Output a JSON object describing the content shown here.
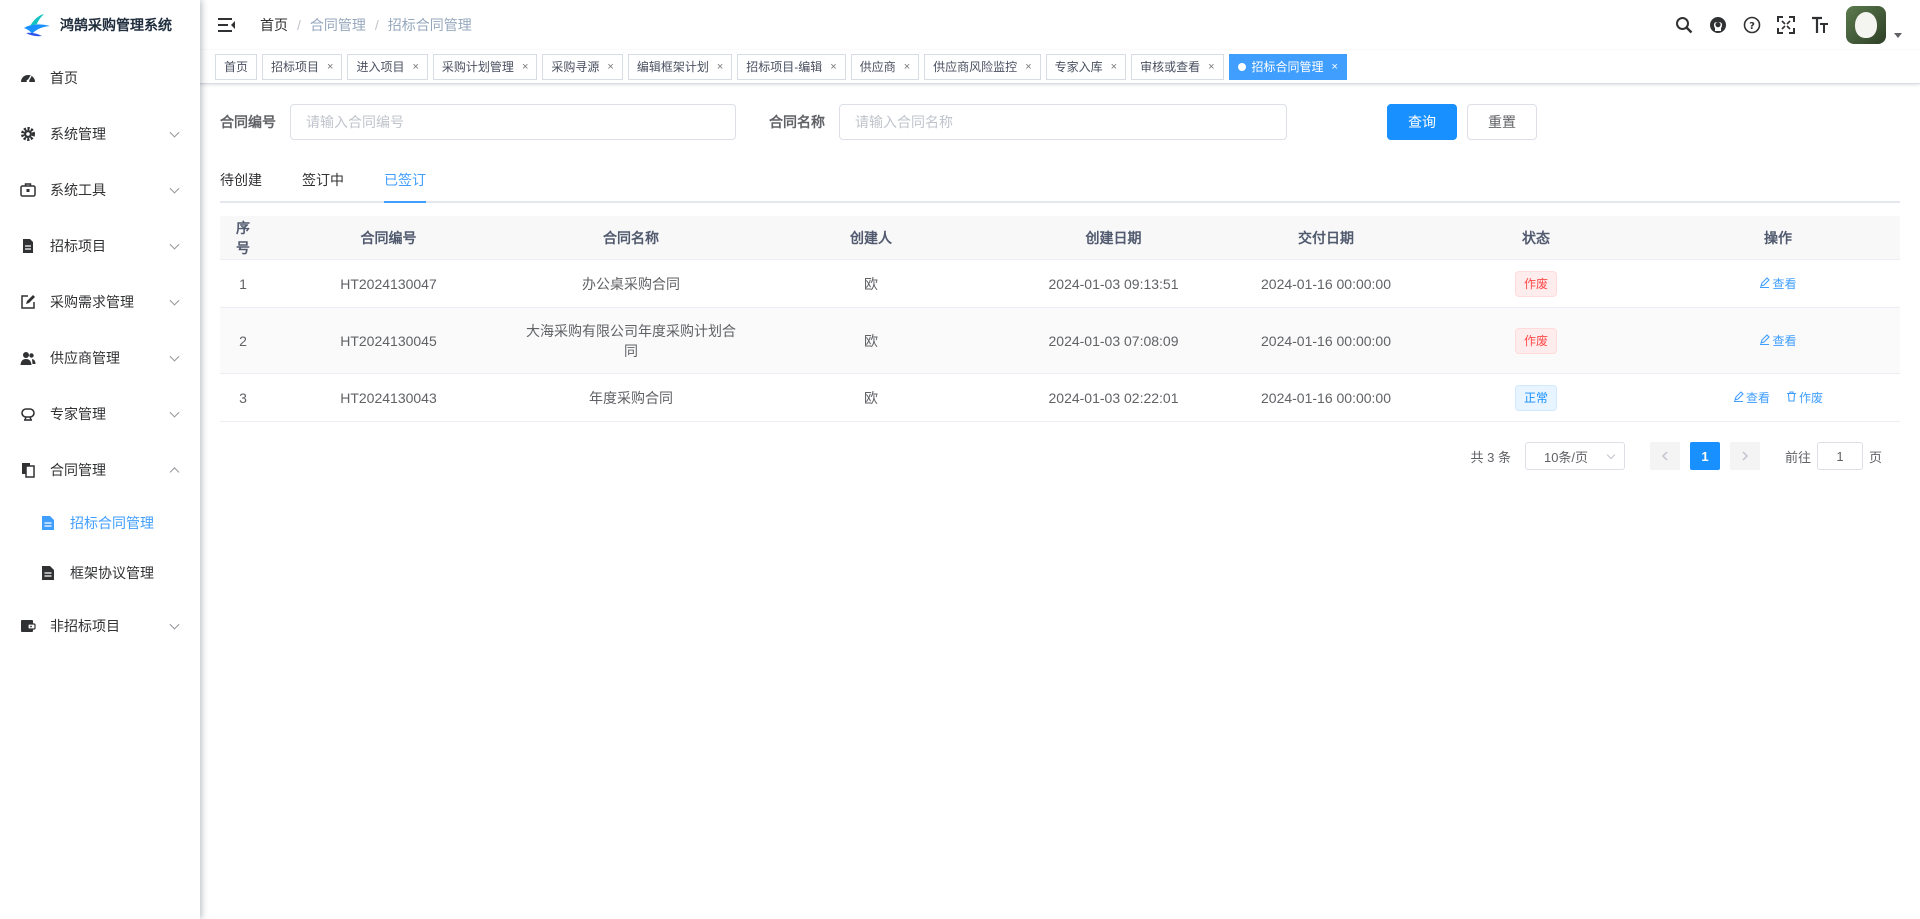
{
  "app": {
    "title": "鸿鹄采购管理系统",
    "accent": "#409eff",
    "primary_button": "#1890ff"
  },
  "sidebar": {
    "items": [
      {
        "label": "首页",
        "icon": "dashboard-icon"
      },
      {
        "label": "系统管理",
        "icon": "gear-icon"
      },
      {
        "label": "系统工具",
        "icon": "toolbox-icon"
      },
      {
        "label": "招标项目",
        "icon": "document-icon"
      },
      {
        "label": "采购需求管理",
        "icon": "edit-icon"
      },
      {
        "label": "供应商管理",
        "icon": "users-icon"
      },
      {
        "label": "专家管理",
        "icon": "expert-icon"
      },
      {
        "label": "合同管理",
        "icon": "copy-icon"
      },
      {
        "label": "非招标项目",
        "icon": "wallet-icon"
      }
    ],
    "subitems": [
      {
        "label": "招标合同管理",
        "icon": "file-icon"
      },
      {
        "label": "框架协议管理",
        "icon": "file-icon"
      }
    ]
  },
  "breadcrumb": [
    "首页",
    "合同管理",
    "招标合同管理"
  ],
  "tags": [
    "首页",
    "招标项目",
    "进入项目",
    "采购计划管理",
    "采购寻源",
    "编辑框架计划",
    "招标项目-编辑",
    "供应商",
    "供应商风险监控",
    "专家入库",
    "审核或查看",
    "招标合同管理"
  ],
  "tag_close": "×",
  "search": {
    "contract_no_label": "合同编号",
    "contract_no_placeholder": "请输入合同编号",
    "contract_name_label": "合同名称",
    "contract_name_placeholder": "请输入合同名称",
    "query_label": "查询",
    "reset_label": "重置"
  },
  "tabs": [
    "待创建",
    "签订中",
    "已签订"
  ],
  "table": {
    "headers": [
      "序号",
      "合同编号",
      "合同名称",
      "创建人",
      "创建日期",
      "交付日期",
      "状态",
      "操作"
    ],
    "rows": [
      {
        "no": "1",
        "code": "HT2024130047",
        "name": "办公桌采购合同",
        "creator": "欧",
        "created": "2024-01-03 09:13:51",
        "delivery": "2024-01-16 00:00:00",
        "status": "作废",
        "ops": [
          "查看"
        ]
      },
      {
        "no": "2",
        "code": "HT2024130045",
        "name": "大海采购有限公司年度采购计划合同",
        "creator": "欧",
        "created": "2024-01-03 07:08:09",
        "delivery": "2024-01-16 00:00:00",
        "status": "作废",
        "ops": [
          "查看"
        ]
      },
      {
        "no": "3",
        "code": "HT2024130043",
        "name": "年度采购合同",
        "creator": "欧",
        "created": "2024-01-03 02:22:01",
        "delivery": "2024-01-16 00:00:00",
        "status": "正常",
        "ops": [
          "查看",
          "作废"
        ]
      }
    ]
  },
  "pagination": {
    "total": "共 3 条",
    "page_size": "10条/页",
    "current": "1",
    "goto_prefix": "前往",
    "goto_value": "1",
    "goto_suffix": "页"
  }
}
